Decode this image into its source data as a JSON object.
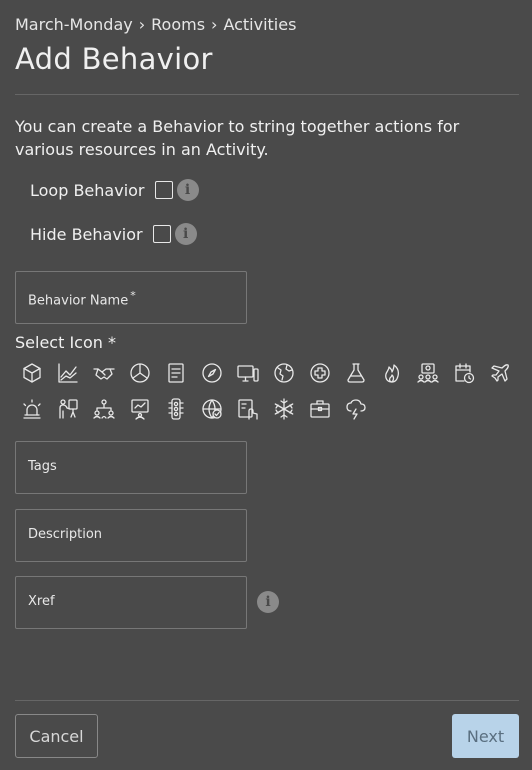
{
  "breadcrumb": [
    "March-Monday",
    "Rooms",
    "Activities"
  ],
  "breadcrumb_separator": "›",
  "page_title": "Add Behavior",
  "description": "You can create a Behavior to string together actions for various resources in an Activity.",
  "loop_behavior": {
    "label": "Loop Behavior",
    "checked": false
  },
  "hide_behavior": {
    "label": "Hide Behavior",
    "checked": false
  },
  "info_glyph": "i",
  "behavior_name": {
    "label": "Behavior Name",
    "required_mark": "*"
  },
  "select_icon_label": "Select Icon *",
  "icons": [
    "cube-icon",
    "line-chart-icon",
    "handshake-icon",
    "pie-chart-icon",
    "document-icon",
    "compass-icon",
    "devices-icon",
    "globe-icon",
    "medical-cross-icon",
    "flask-icon",
    "fire-icon",
    "team-icon",
    "calendar-clock-icon",
    "airplane-icon",
    "alarm-light-icon",
    "presenter-icon",
    "hierarchy-icon",
    "whiteboard-icon",
    "traffic-light-icon",
    "globe-grid-icon",
    "tablet-touch-icon",
    "snowflake-icon",
    "briefcase-icon",
    "storm-icon"
  ],
  "tags": {
    "label": "Tags"
  },
  "description_field": {
    "label": "Description"
  },
  "xref": {
    "label": "Xref"
  },
  "buttons": {
    "cancel": "Cancel",
    "next": "Next"
  },
  "colors": {
    "background": "#4a4a4a",
    "next_button": "#b8d3e9",
    "info_icon": "#8a8a8a"
  }
}
